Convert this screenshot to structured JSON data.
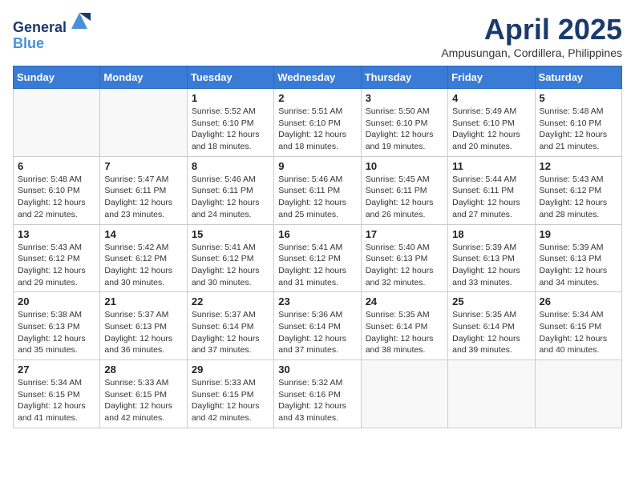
{
  "header": {
    "logo_line1": "General",
    "logo_line2": "Blue",
    "month": "April 2025",
    "location": "Ampusungan, Cordillera, Philippines"
  },
  "days_of_week": [
    "Sunday",
    "Monday",
    "Tuesday",
    "Wednesday",
    "Thursday",
    "Friday",
    "Saturday"
  ],
  "weeks": [
    [
      {
        "day": "",
        "info": ""
      },
      {
        "day": "",
        "info": ""
      },
      {
        "day": "1",
        "info": "Sunrise: 5:52 AM\nSunset: 6:10 PM\nDaylight: 12 hours and 18 minutes."
      },
      {
        "day": "2",
        "info": "Sunrise: 5:51 AM\nSunset: 6:10 PM\nDaylight: 12 hours and 18 minutes."
      },
      {
        "day": "3",
        "info": "Sunrise: 5:50 AM\nSunset: 6:10 PM\nDaylight: 12 hours and 19 minutes."
      },
      {
        "day": "4",
        "info": "Sunrise: 5:49 AM\nSunset: 6:10 PM\nDaylight: 12 hours and 20 minutes."
      },
      {
        "day": "5",
        "info": "Sunrise: 5:48 AM\nSunset: 6:10 PM\nDaylight: 12 hours and 21 minutes."
      }
    ],
    [
      {
        "day": "6",
        "info": "Sunrise: 5:48 AM\nSunset: 6:10 PM\nDaylight: 12 hours and 22 minutes."
      },
      {
        "day": "7",
        "info": "Sunrise: 5:47 AM\nSunset: 6:11 PM\nDaylight: 12 hours and 23 minutes."
      },
      {
        "day": "8",
        "info": "Sunrise: 5:46 AM\nSunset: 6:11 PM\nDaylight: 12 hours and 24 minutes."
      },
      {
        "day": "9",
        "info": "Sunrise: 5:46 AM\nSunset: 6:11 PM\nDaylight: 12 hours and 25 minutes."
      },
      {
        "day": "10",
        "info": "Sunrise: 5:45 AM\nSunset: 6:11 PM\nDaylight: 12 hours and 26 minutes."
      },
      {
        "day": "11",
        "info": "Sunrise: 5:44 AM\nSunset: 6:11 PM\nDaylight: 12 hours and 27 minutes."
      },
      {
        "day": "12",
        "info": "Sunrise: 5:43 AM\nSunset: 6:12 PM\nDaylight: 12 hours and 28 minutes."
      }
    ],
    [
      {
        "day": "13",
        "info": "Sunrise: 5:43 AM\nSunset: 6:12 PM\nDaylight: 12 hours and 29 minutes."
      },
      {
        "day": "14",
        "info": "Sunrise: 5:42 AM\nSunset: 6:12 PM\nDaylight: 12 hours and 30 minutes."
      },
      {
        "day": "15",
        "info": "Sunrise: 5:41 AM\nSunset: 6:12 PM\nDaylight: 12 hours and 30 minutes."
      },
      {
        "day": "16",
        "info": "Sunrise: 5:41 AM\nSunset: 6:12 PM\nDaylight: 12 hours and 31 minutes."
      },
      {
        "day": "17",
        "info": "Sunrise: 5:40 AM\nSunset: 6:13 PM\nDaylight: 12 hours and 32 minutes."
      },
      {
        "day": "18",
        "info": "Sunrise: 5:39 AM\nSunset: 6:13 PM\nDaylight: 12 hours and 33 minutes."
      },
      {
        "day": "19",
        "info": "Sunrise: 5:39 AM\nSunset: 6:13 PM\nDaylight: 12 hours and 34 minutes."
      }
    ],
    [
      {
        "day": "20",
        "info": "Sunrise: 5:38 AM\nSunset: 6:13 PM\nDaylight: 12 hours and 35 minutes."
      },
      {
        "day": "21",
        "info": "Sunrise: 5:37 AM\nSunset: 6:13 PM\nDaylight: 12 hours and 36 minutes."
      },
      {
        "day": "22",
        "info": "Sunrise: 5:37 AM\nSunset: 6:14 PM\nDaylight: 12 hours and 37 minutes."
      },
      {
        "day": "23",
        "info": "Sunrise: 5:36 AM\nSunset: 6:14 PM\nDaylight: 12 hours and 37 minutes."
      },
      {
        "day": "24",
        "info": "Sunrise: 5:35 AM\nSunset: 6:14 PM\nDaylight: 12 hours and 38 minutes."
      },
      {
        "day": "25",
        "info": "Sunrise: 5:35 AM\nSunset: 6:14 PM\nDaylight: 12 hours and 39 minutes."
      },
      {
        "day": "26",
        "info": "Sunrise: 5:34 AM\nSunset: 6:15 PM\nDaylight: 12 hours and 40 minutes."
      }
    ],
    [
      {
        "day": "27",
        "info": "Sunrise: 5:34 AM\nSunset: 6:15 PM\nDaylight: 12 hours and 41 minutes."
      },
      {
        "day": "28",
        "info": "Sunrise: 5:33 AM\nSunset: 6:15 PM\nDaylight: 12 hours and 42 minutes."
      },
      {
        "day": "29",
        "info": "Sunrise: 5:33 AM\nSunset: 6:15 PM\nDaylight: 12 hours and 42 minutes."
      },
      {
        "day": "30",
        "info": "Sunrise: 5:32 AM\nSunset: 6:16 PM\nDaylight: 12 hours and 43 minutes."
      },
      {
        "day": "",
        "info": ""
      },
      {
        "day": "",
        "info": ""
      },
      {
        "day": "",
        "info": ""
      }
    ]
  ]
}
